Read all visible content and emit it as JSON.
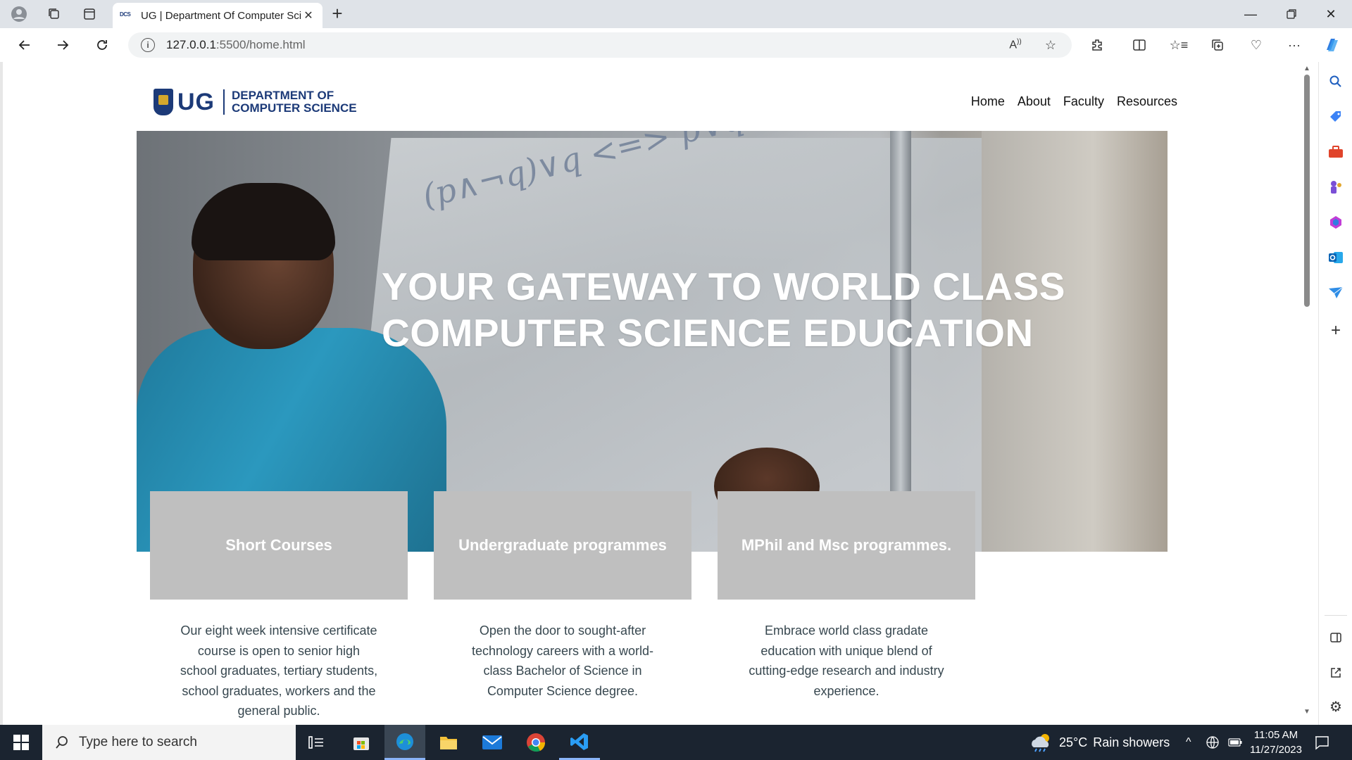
{
  "browser": {
    "tab_title": "UG | Department Of Computer Science",
    "url_host": "127.0.0.1",
    "url_rest": ":5500/home.html",
    "favicon_text": "DCS"
  },
  "site": {
    "logo_ug": "UG",
    "logo_line1": "DEPARTMENT OF",
    "logo_line2": "COMPUTER SCIENCE",
    "nav": [
      "Home",
      "About",
      "Faculty",
      "Resources"
    ],
    "hero_line1": "YOUR GATEWAY TO WORLD CLASS",
    "hero_line2": "COMPUTER SCIENCE EDUCATION",
    "hero_board_text": "(p∧¬q)∨q <=> p∨q",
    "cards": [
      {
        "title": "Short Courses",
        "desc": "Our eight week intensive certificate course is open to senior high school graduates, tertiary students, school graduates, workers and the general public."
      },
      {
        "title": "Undergraduate programmes",
        "desc": "Open the door to sought-after technology careers with a world-class Bachelor of Science in Computer Science degree."
      },
      {
        "title": "MPhil and Msc programmes.",
        "desc": "Embrace world class gradate education with unique blend of cutting-edge research and industry experience."
      }
    ]
  },
  "taskbar": {
    "search_placeholder": "Type here to search",
    "weather_temp": "25°C",
    "weather_desc": "Rain showers",
    "time": "11:05 AM",
    "date": "11/27/2023"
  },
  "colors": {
    "brand_blue": "#1c3a78",
    "card_grey": "#bfbfbf",
    "taskbar": "#1b2430"
  }
}
